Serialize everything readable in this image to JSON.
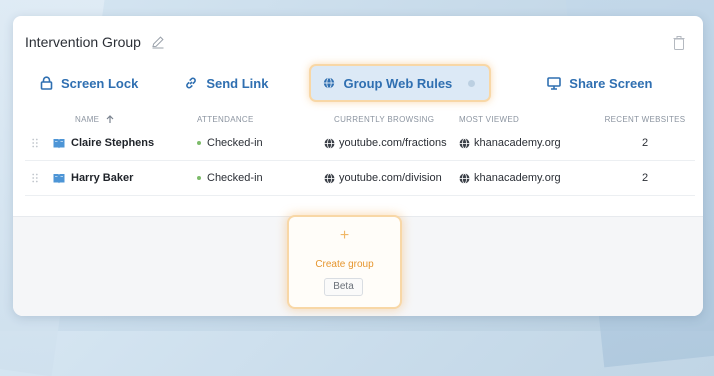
{
  "group": {
    "title": "Intervention Group"
  },
  "toolbar": {
    "screen_lock": "Screen Lock",
    "send_link": "Send Link",
    "group_web_rules": "Group Web Rules",
    "share_screen": "Share Screen"
  },
  "table": {
    "headers": {
      "name": "NAME",
      "attendance": "ATTENDANCE",
      "currently_browsing": "CURRENTLY BROWSING",
      "most_viewed": "MOST VIEWED",
      "recent_websites": "RECENT WEBSITES"
    },
    "rows": [
      {
        "name": "Claire Stephens",
        "attendance": "Checked-in",
        "currently_browsing": "youtube.com/fractions",
        "most_viewed": "khanacademy.org",
        "recent_websites": "2"
      },
      {
        "name": "Harry Baker",
        "attendance": "Checked-in",
        "currently_browsing": "youtube.com/division",
        "most_viewed": "khanacademy.org",
        "recent_websites": "2"
      }
    ]
  },
  "create_group": {
    "plus": "+",
    "label": "Create group",
    "badge": "Beta"
  },
  "colors": {
    "accent_blue": "#2f6fb1",
    "highlight_orange": "#f5aa50",
    "checked_in_green": "#7dbb6a"
  },
  "icons": {
    "edit": "pencil-icon",
    "delete": "trash-icon",
    "screen_lock": "lock-icon",
    "send_link": "link-icon",
    "group_web_rules": "globe-icon",
    "share_screen": "monitor-icon",
    "sort": "arrow-up-icon",
    "drag": "drag-handle-icon",
    "student": "book-icon",
    "site": "globe-icon"
  }
}
